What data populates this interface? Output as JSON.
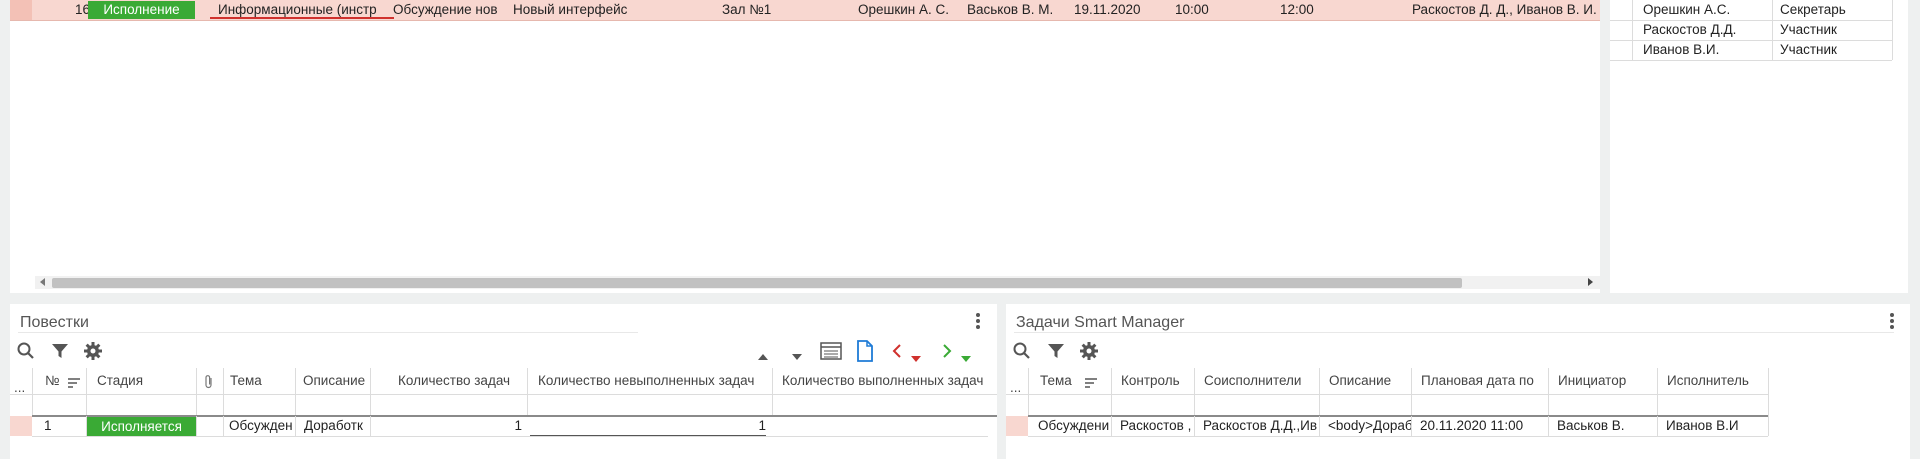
{
  "top_table": {
    "row": {
      "num": "16",
      "stage": "Исполнение",
      "type": "Информационные (инстр",
      "topic": "Обсуждение нов",
      "description": "Новый интерфейс",
      "place": "Зал №1",
      "secretary": "Орешкин А. С.",
      "initiator": "Васьков В. М.",
      "date": "19.11.2020",
      "start": "10:00",
      "end": "12:00",
      "participants": "Раскостов Д. Д., Иванов В. И."
    }
  },
  "participants_panel": {
    "rows": [
      {
        "name": "Орешкин А.С.",
        "role": "Секретарь"
      },
      {
        "name": "Раскостов Д.Д.",
        "role": "Участник"
      },
      {
        "name": "Иванов В.И.",
        "role": "Участник"
      }
    ]
  },
  "agenda_panel": {
    "title": "Повестки",
    "headers": {
      "dots": "...",
      "num": "№",
      "stage": "Стадия",
      "topic": "Тема",
      "description": "Описание",
      "tasks_count": "Количество задач",
      "tasks_undone": "Количество невыполненных задач",
      "tasks_done": "Количество выполненных задач"
    },
    "row": {
      "num": "1",
      "stage": "Исполняется",
      "topic": "Обсужден",
      "description": "Доработк",
      "tasks_count": "1",
      "tasks_undone": "1",
      "tasks_done": ""
    }
  },
  "tasks_panel": {
    "title": "Задачи Smart Manager",
    "headers": {
      "dots": "...",
      "topic": "Тема",
      "control": "Контроль",
      "coexecutors": "Соисполнители",
      "description": "Описание",
      "planned_date": "Плановая дата по",
      "initiator": "Инициатор",
      "executor": "Исполнитель"
    },
    "row": {
      "topic": "Обсуждени",
      "control": "Раскостов ,",
      "coexecutors": "Раскостов Д.Д.,Ив",
      "description": "<body>Дораб",
      "planned_date": "20.11.2020 11:00",
      "initiator": "Васьков В.",
      "executor": "Иванов В.И"
    }
  },
  "colors": {
    "accent_green": "#3aaa35",
    "selected_row": "#f8d7d0",
    "red_underline": "#d0312d",
    "nav_red": "#d0312d",
    "nav_green": "#3aaa35",
    "blue_doc": "#1e7bd6"
  }
}
